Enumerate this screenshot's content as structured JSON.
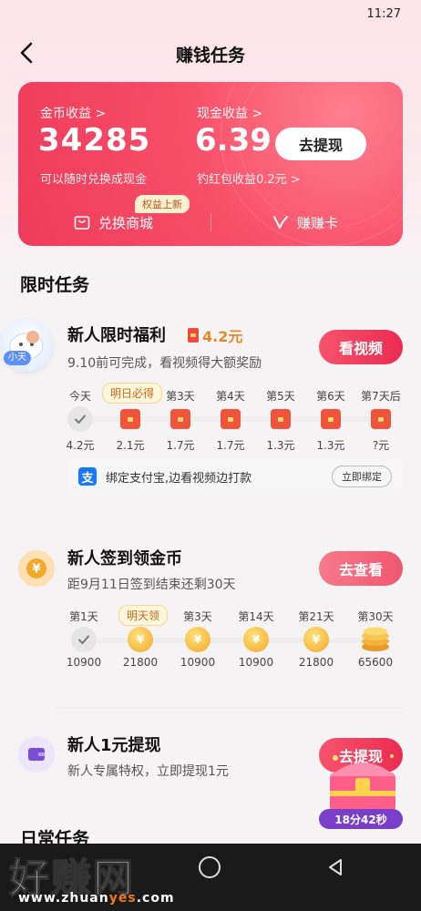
{
  "status": {
    "time": "11:27"
  },
  "nav": {
    "title": "赚钱任务"
  },
  "card": {
    "coin_label": "金币收益 >",
    "coin_value": "34285",
    "coin_sub": "可以随时兑换成现金",
    "cash_label": "现金收益 >",
    "cash_value": "6.39",
    "cash_sub": "钓红包收益0.2元 >",
    "withdraw_label": "去提现",
    "shop_label": "兑换商城",
    "shop_badge": "权益上新",
    "card_label": "赚赚卡"
  },
  "section_limited": "限时任务",
  "mascot_label": "小天",
  "task1": {
    "title": "新人限时福利",
    "reward": "4.2元",
    "desc": "9.10前可完成，看视频得大额奖励",
    "cta": "看视频",
    "tip": "明日必得",
    "days": [
      {
        "day": "今天",
        "amount": "4.2元",
        "state": "done"
      },
      {
        "day": "",
        "amount": "2.1元",
        "state": "envelope"
      },
      {
        "day": "第3天",
        "amount": "1.7元",
        "state": "envelope"
      },
      {
        "day": "第4天",
        "amount": "1.7元",
        "state": "envelope"
      },
      {
        "day": "第5天",
        "amount": "1.3元",
        "state": "envelope"
      },
      {
        "day": "第6天",
        "amount": "1.3元",
        "state": "envelope"
      },
      {
        "day": "第7天后",
        "amount": "?元",
        "state": "envelope"
      }
    ],
    "alipay_text": "绑定支付宝,边看视频边打款",
    "bind_label": "立即绑定"
  },
  "task2": {
    "title": "新人签到领金币",
    "desc": "距9月11日签到结束还剩30天",
    "cta": "去查看",
    "tip": "明天领",
    "days": [
      {
        "day": "第1天",
        "amount": "10900",
        "state": "done"
      },
      {
        "day": "",
        "amount": "21800",
        "state": "coin"
      },
      {
        "day": "第3天",
        "amount": "10900",
        "state": "coin"
      },
      {
        "day": "第14天",
        "amount": "10900",
        "state": "coin"
      },
      {
        "day": "第21天",
        "amount": "21800",
        "state": "coin"
      },
      {
        "day": "第30天",
        "amount": "65600",
        "state": "bigcoin"
      }
    ]
  },
  "task3": {
    "title": "新人1元提现",
    "desc": "新人专属特权，立即提现1元",
    "cta": "去提现"
  },
  "chest_timer": "18分42秒",
  "section_daily": "日常任务",
  "watermark": {
    "main": "好赚网",
    "sub_pre": "www.zhuan",
    "sub_hl": "yes",
    "sub_post": ".com"
  },
  "colors": {
    "accent": "#ef3b5b",
    "gold": "#e4892a"
  }
}
